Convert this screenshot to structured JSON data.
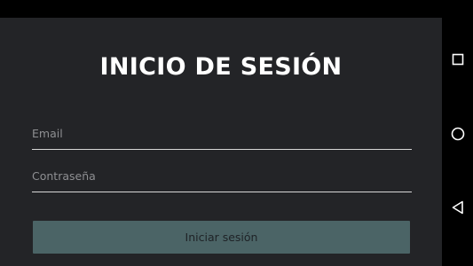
{
  "login": {
    "title": "INICIO DE SESIÓN",
    "email_placeholder": "Email",
    "password_placeholder": "Contraseña",
    "submit_label": "Iniciar sesión"
  },
  "system_nav": {
    "buttons": [
      "square-recents-icon",
      "circle-home-icon",
      "triangle-back-icon"
    ]
  },
  "colors": {
    "background": "#232427",
    "button": "#4b6466",
    "title_text": "#ffffff",
    "placeholder_text": "#8e8f92",
    "underline": "#d7d7d7",
    "nav_bar": "#000000"
  }
}
